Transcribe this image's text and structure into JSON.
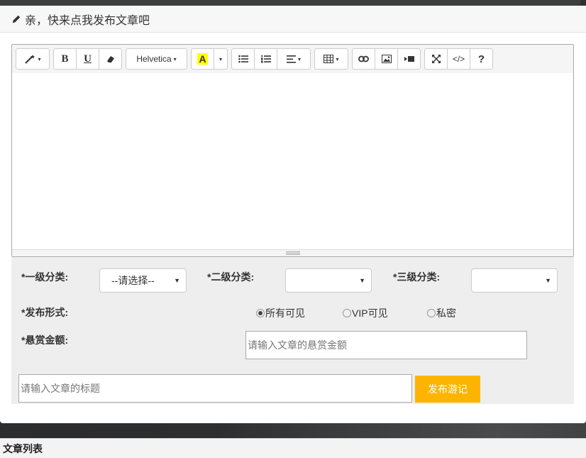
{
  "modal": {
    "title": "亲，快来点我发布文章吧"
  },
  "toolbar": {
    "style_caret": "▾",
    "bold": "B",
    "underline": "U",
    "font_name": "Helvetica",
    "color_letter": "A",
    "highlight_color": "#ffff00",
    "help": "?",
    "code": "</>"
  },
  "form": {
    "level1_label": "*一级分类:",
    "level1_value": "--请选择--",
    "level2_label": "*二级分类:",
    "level2_value": "",
    "level3_label": "*三级分类:",
    "level3_value": "",
    "publish_label": "*发布形式:",
    "visibility_options": [
      {
        "label": "所有可见",
        "checked": true
      },
      {
        "label": "VIP可见",
        "checked": false
      },
      {
        "label": "私密",
        "checked": false
      }
    ],
    "reward_label": "*悬赏金额:",
    "reward_placeholder": "请输入文章的悬赏金额",
    "title_placeholder": "请输入文章的标题",
    "submit_label": "发布游记",
    "accent_color": "#fdb400"
  },
  "bottom": {
    "section_title": "文章列表"
  }
}
